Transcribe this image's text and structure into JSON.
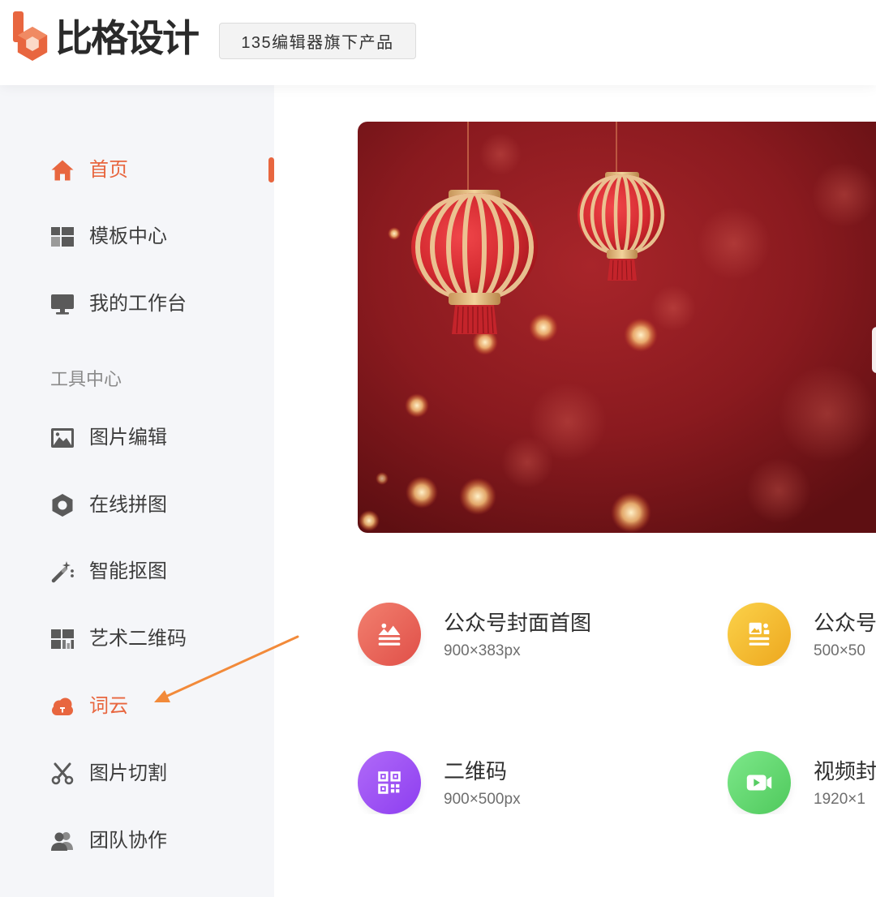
{
  "header": {
    "brand": {
      "logo_icon": "bige-logo-icon",
      "name": "比格设计"
    },
    "badge": "135编辑器旗下产品"
  },
  "sidebar": {
    "nav": [
      {
        "label": "首页",
        "icon": "home-icon",
        "active": true
      },
      {
        "label": "模板中心",
        "icon": "template-grid-icon",
        "active": false
      },
      {
        "label": "我的工作台",
        "icon": "monitor-icon",
        "active": false
      }
    ],
    "tools_section_label": "工具中心",
    "tools": [
      {
        "label": "图片编辑",
        "icon": "image-edit-icon",
        "highlighted": false
      },
      {
        "label": "在线拼图",
        "icon": "collage-hexagon-icon",
        "highlighted": false
      },
      {
        "label": "智能抠图",
        "icon": "magic-wand-icon",
        "highlighted": false
      },
      {
        "label": "艺术二维码",
        "icon": "art-qrcode-icon",
        "highlighted": false
      },
      {
        "label": "词云",
        "icon": "word-cloud-icon",
        "highlighted": true
      },
      {
        "label": "图片切割",
        "icon": "scissors-icon",
        "highlighted": false
      },
      {
        "label": "团队协作",
        "icon": "team-icon",
        "highlighted": false
      }
    ]
  },
  "cards": [
    {
      "title": "公众号封面首图",
      "size": "900×383px",
      "icon": "cover-image-icon",
      "color_from": "#f2806f",
      "color_to": "#e04f48"
    },
    {
      "title": "公众号",
      "size": "500×50",
      "icon": "article-image-icon",
      "color_from": "#fbd24a",
      "color_to": "#eda71e"
    },
    {
      "title": "二维码",
      "size": "900×500px",
      "icon": "qrcode-icon",
      "color_from": "#b06af8",
      "color_to": "#8d3ef0"
    },
    {
      "title": "视频封",
      "size": "1920×1",
      "icon": "video-camera-icon",
      "color_from": "#7de88a",
      "color_to": "#4fc95c"
    }
  ],
  "colors": {
    "accent": "#e8663f",
    "sidebar_bg": "#f5f6f9",
    "annotation_arrow": "#f28a3a"
  }
}
